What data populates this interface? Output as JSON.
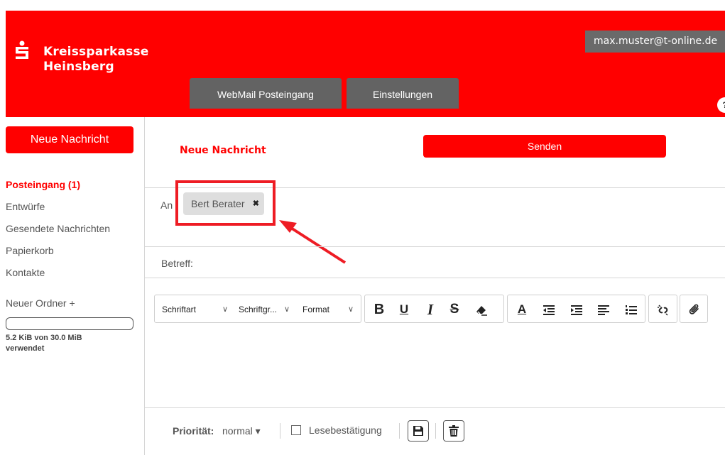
{
  "header": {
    "brand_line1": "Kreissparkasse",
    "brand_line2": "Heinsberg",
    "user_email": "max.muster@t-online.de",
    "tabs": [
      {
        "label": "WebMail Posteingang"
      },
      {
        "label": "Einstellungen"
      }
    ],
    "help_icon": "?"
  },
  "sidebar": {
    "new_message_label": "Neue Nachricht",
    "folders": [
      {
        "label": "Posteingang (1)",
        "active": true
      },
      {
        "label": "Entwürfe"
      },
      {
        "label": "Gesendete Nachrichten"
      },
      {
        "label": "Papierkorb"
      },
      {
        "label": "Kontakte"
      }
    ],
    "new_folder_label": "Neuer Ordner +",
    "quota_text": "5.2 KiB von 30.0 MiB verwendet",
    "quota_fraction": 0.0002
  },
  "compose": {
    "title": "Neue Nachricht",
    "send_label": "Senden",
    "to_label": "An",
    "recipient": "Bert Berater",
    "recipient_remove": "✖",
    "subject_label": "Betreff:",
    "subject_value": ""
  },
  "toolbar": {
    "font_label": "Schriftart",
    "size_label": "Schriftgr...",
    "format_label": "Format",
    "chevron": "∨",
    "icons": [
      "bold-icon",
      "underline-icon",
      "italic-icon",
      "strikethrough-icon",
      "eraser-icon",
      "text-color-icon",
      "outdent-icon",
      "indent-icon",
      "align-left-icon",
      "ordered-list-icon",
      "unlink-icon",
      "attachment-icon"
    ]
  },
  "footer": {
    "priority_label": "Priorität:",
    "priority_value": "normal ▾",
    "read_receipt_label": "Lesebestätigung",
    "checkbox_checked": false,
    "icons": [
      "save-icon",
      "trash-icon"
    ]
  },
  "colors": {
    "brand_red": "#ff0000",
    "tab_gray": "#636363",
    "annotation_red": "#ee1c24"
  }
}
